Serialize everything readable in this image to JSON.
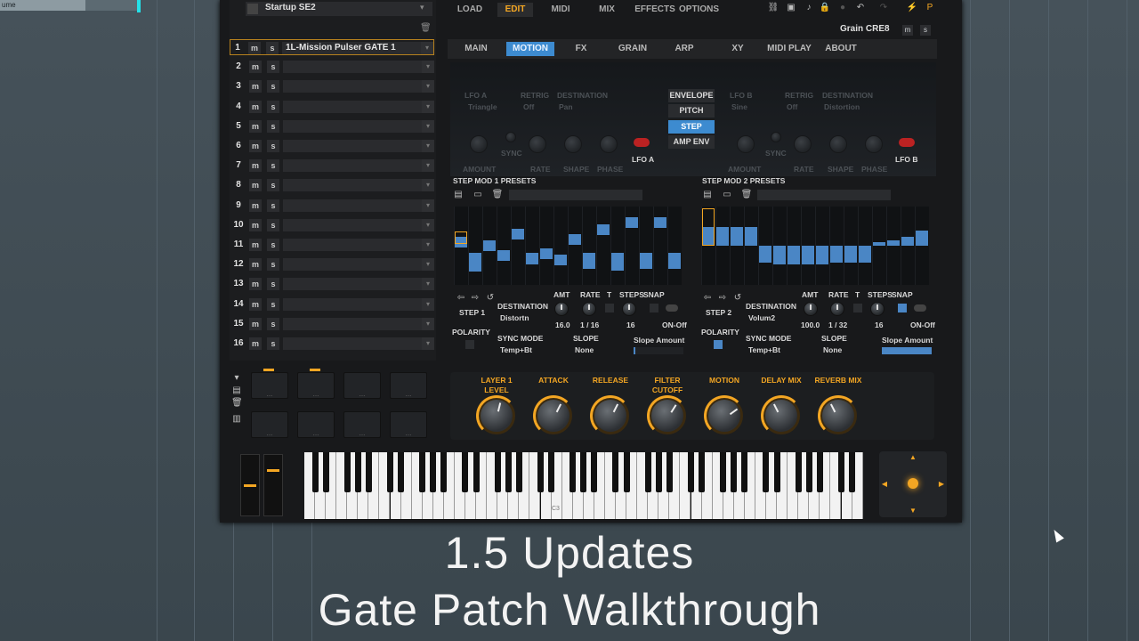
{
  "daw": {
    "track_label": "ume"
  },
  "multi_header": {
    "preset_name": "Startup SE2"
  },
  "slots": [
    {
      "num": "1",
      "name": "1L-Mission Pulser GATE 1"
    },
    {
      "num": "2",
      "name": ""
    },
    {
      "num": "3",
      "name": ""
    },
    {
      "num": "4",
      "name": ""
    },
    {
      "num": "5",
      "name": ""
    },
    {
      "num": "6",
      "name": ""
    },
    {
      "num": "7",
      "name": ""
    },
    {
      "num": "8",
      "name": ""
    },
    {
      "num": "9",
      "name": ""
    },
    {
      "num": "10",
      "name": ""
    },
    {
      "num": "11",
      "name": ""
    },
    {
      "num": "12",
      "name": ""
    },
    {
      "num": "13",
      "name": ""
    },
    {
      "num": "14",
      "name": ""
    },
    {
      "num": "15",
      "name": ""
    },
    {
      "num": "16",
      "name": ""
    }
  ],
  "slot_btn": {
    "m": "m",
    "s": "s"
  },
  "top_nav": {
    "load": "LOAD",
    "edit": "EDIT",
    "midi": "MIDI",
    "mix": "MIX",
    "effects": "EFFECTS",
    "options": "OPTIONS"
  },
  "instrument": {
    "name": "Grain CRE8",
    "m": "m",
    "s": "s"
  },
  "sub_tabs": {
    "main": "MAIN",
    "motion": "MOTION",
    "fx": "FX",
    "grain": "GRAIN",
    "arp": "ARP",
    "xy": "XY",
    "midi_play": "MIDI PLAY",
    "about": "ABOUT"
  },
  "lfo_a": {
    "title": "LFO A",
    "retrig": "RETRIG",
    "destination": "DESTINATION",
    "wave": "Triangle",
    "retrig_val": "Off",
    "dest_val": "Pan",
    "amount": "AMOUNT",
    "sync": "SYNC",
    "rate": "RATE",
    "shape": "SHAPE",
    "phase": "PHASE",
    "label": "LFO A"
  },
  "lfo_b": {
    "title": "LFO B",
    "retrig": "RETRIG",
    "destination": "DESTINATION",
    "wave": "Sine",
    "retrig_val": "Off",
    "dest_val": "Distortion",
    "amount": "AMOUNT",
    "sync": "SYNC",
    "rate": "RATE",
    "shape": "SHAPE",
    "phase": "PHASE",
    "label": "LFO B"
  },
  "mod_modes": {
    "envelope": "ENVELOPE",
    "pitch": "PITCH",
    "step": "STEP",
    "amp_env": "AMP ENV"
  },
  "step1": {
    "presets": "STEP MOD 1 PRESETS",
    "step": "STEP 1",
    "destination": "DESTINATION",
    "dest_val": "Distortn",
    "amt": "AMT",
    "rate": "RATE",
    "t": "T",
    "steps": "STEPS",
    "snap": "SNAP",
    "amt_val": "16.0",
    "rate_val": "1 / 16",
    "steps_val": "16",
    "onoff": "ON-Off",
    "polarity": "POLARITY",
    "sync_mode": "SYNC MODE",
    "sync_val": "Temp+Bt",
    "slope": "SLOPE",
    "slope_val": "None",
    "slope_amount": "Slope Amount",
    "values": [
      0.55,
      0.1,
      0.5,
      0.38,
      0.65,
      0.25,
      0.4,
      0.32,
      0.58,
      0.15,
      0.7,
      0.12,
      0.8,
      0.15,
      0.8,
      0.15
    ]
  },
  "step2": {
    "presets": "STEP MOD 2 PRESETS",
    "step": "STEP 2",
    "destination": "DESTINATION",
    "dest_val": "Volum2",
    "amt": "AMT",
    "rate": "RATE",
    "t": "T",
    "steps": "STEPS",
    "snap": "SNAP",
    "amt_val": "100.0",
    "rate_val": "1 / 32",
    "steps_val": "16",
    "onoff": "ON-Off",
    "polarity": "POLARITY",
    "sync_mode": "SYNC MODE",
    "sync_val": "Temp+Bt",
    "slope": "SLOPE",
    "slope_val": "None",
    "slope_amount": "Slope Amount",
    "values": [
      0.5,
      0.5,
      0.5,
      0.5,
      -0.45,
      -0.5,
      -0.5,
      -0.5,
      -0.5,
      -0.45,
      -0.45,
      -0.45,
      0.05,
      0.15,
      0.25,
      0.4
    ]
  },
  "macros": [
    {
      "label": "LAYER 1\nLEVEL",
      "level": 0.55
    },
    {
      "label": "ATTACK",
      "level": 0.6
    },
    {
      "label": "RELEASE",
      "level": 0.6
    },
    {
      "label": "FILTER\nCUTOFF",
      "level": 0.62
    },
    {
      "label": "MOTION",
      "level": 0.7
    },
    {
      "label": "DELAY MIX",
      "level": 0.4
    },
    {
      "label": "REVERB MIX",
      "level": 0.4
    }
  ],
  "keyboard": {
    "c3_label": "C3"
  },
  "caption": {
    "line1": "1.5 Updates",
    "line2": "Gate Patch Walkthrough"
  },
  "colors": {
    "accent": "#f3a623",
    "step_blue": "#4a86c5",
    "tab_blue": "#3d8bd0"
  }
}
